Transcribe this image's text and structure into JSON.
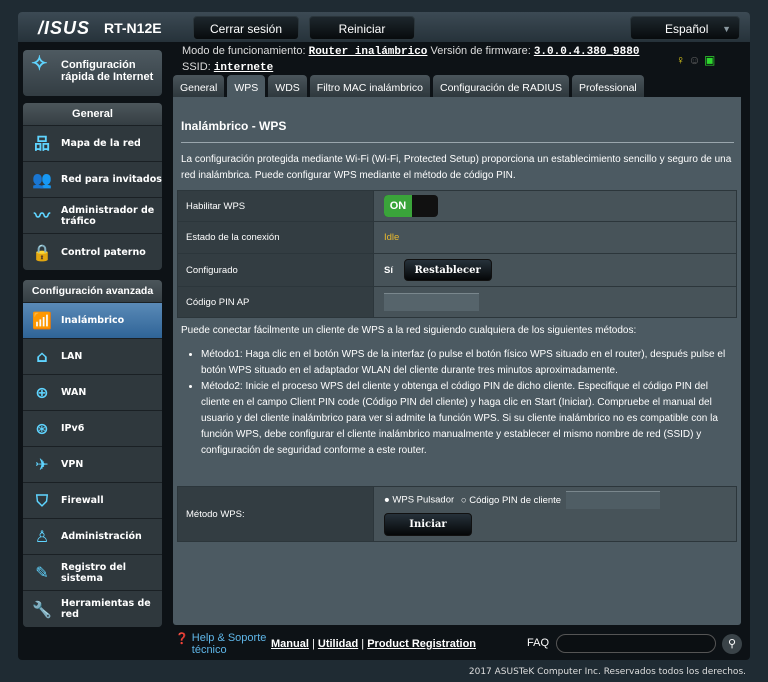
{
  "header": {
    "brand": "/ISUS",
    "model": "RT-N12E",
    "logout": "Cerrar sesión",
    "reboot": "Reiniciar",
    "language": "Español"
  },
  "info": {
    "mode_label": "Modo de funcionamiento:",
    "mode_value": "Router inalámbrico",
    "fw_label": "Versión de firmware:",
    "fw_value": "3.0.0.4.380_9880",
    "ssid_label": "SSID:",
    "ssid_value": "internete"
  },
  "sidebar": {
    "quick_setup": "Configuración rápida de Internet",
    "general_title": "General",
    "general": [
      {
        "label": "Mapa de la red",
        "icon": "network-map-icon"
      },
      {
        "label": "Red para invitados",
        "icon": "guest-network-icon"
      },
      {
        "label": "Administrador de tráfico",
        "icon": "traffic-icon"
      },
      {
        "label": "Control paterno",
        "icon": "lock-icon"
      }
    ],
    "advanced_title": "Configuración avanzada",
    "advanced": [
      {
        "label": "Inalámbrico",
        "icon": "wifi-icon"
      },
      {
        "label": "LAN",
        "icon": "home-icon"
      },
      {
        "label": "WAN",
        "icon": "globe-icon"
      },
      {
        "label": "IPv6",
        "icon": "ipv6-icon"
      },
      {
        "label": "VPN",
        "icon": "vpn-icon"
      },
      {
        "label": "Firewall",
        "icon": "shield-icon"
      },
      {
        "label": "Administración",
        "icon": "user-icon"
      },
      {
        "label": "Registro del sistema",
        "icon": "log-icon"
      },
      {
        "label": "Herramientas de red",
        "icon": "wrench-icon"
      }
    ]
  },
  "tabs": [
    "General",
    "WPS",
    "WDS",
    "Filtro MAC inalámbrico",
    "Configuración de RADIUS",
    "Professional"
  ],
  "main": {
    "title": "Inalámbrico - WPS",
    "description": "La configuración protegida mediante Wi-Fi (Wi-Fi, Protected Setup) proporciona un establecimiento sencillo y seguro de una red inalámbrica. Puede configurar WPS mediante el método de código PIN.",
    "enable_label": "Habilitar WPS",
    "enable_value": "ON",
    "status_label": "Estado de la conexión",
    "status_value": "Idle",
    "configured_label": "Configurado",
    "configured_value": "Sí",
    "reset_button": "Restablecer",
    "pin_label": "Código PIN AP",
    "pin_value": "",
    "methods_intro": "Puede conectar fácilmente un cliente de WPS a la red siguiendo cualquiera de los siguientes métodos:",
    "method1": "Método1: Haga clic en el botón WPS de la interfaz (o pulse el botón físico WPS situado en el router), después pulse el botón WPS situado en el adaptador WLAN del cliente durante tres minutos aproximadamente.",
    "method2": "Método2: Inicie el proceso WPS del cliente y obtenga el código PIN de dicho cliente. Especifique el código PIN del cliente en el campo Client PIN code (Código PIN del cliente) y haga clic en Start (Iniciar). Compruebe el manual del usuario y del cliente inalámbrico para ver si admite la función WPS. Si su cliente inalámbrico no es compatible con la función WPS, debe configurar el cliente inalámbrico manualmente y establecer el mismo nombre de red (SSID) y configuración de seguridad conforme a este router.",
    "method_label": "Método WPS:",
    "radio_push": "WPS Pulsador",
    "radio_pin": "Código PIN de cliente",
    "start_button": "Iniciar"
  },
  "footer": {
    "help": "Help & Soporte técnico",
    "manual": "Manual",
    "utility": "Utilidad",
    "registration": "Product Registration",
    "faq": "FAQ",
    "copyright": "2017 ASUSTeK Computer Inc. Reservados todos los derechos."
  }
}
